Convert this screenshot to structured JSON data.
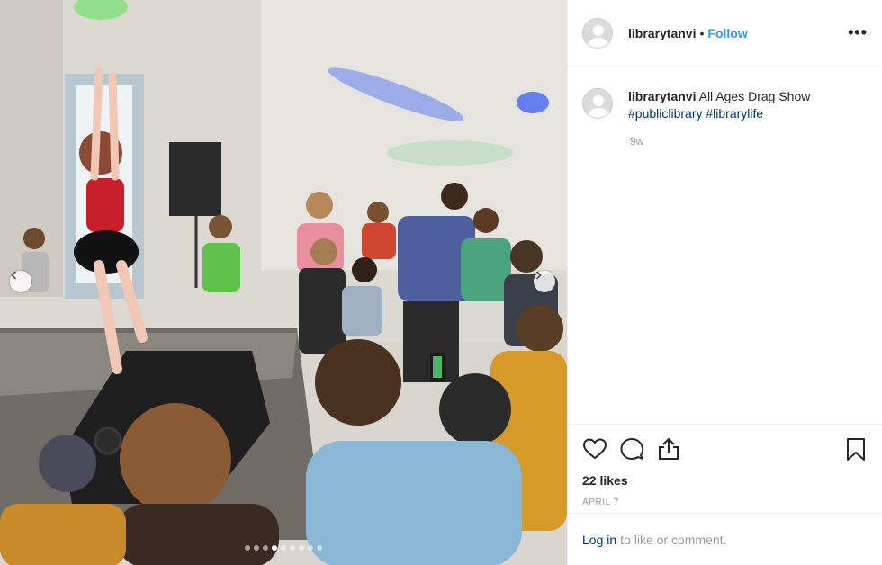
{
  "post": {
    "photo_alt": "Photo",
    "slide_count": 9,
    "active_slide": 3
  },
  "header": {
    "username": "librarytanvi",
    "separator": "•",
    "follow_label": "Follow",
    "more_label": "•••"
  },
  "caption": {
    "username": "librarytanvi",
    "text": "All Ages Drag Show",
    "hashtags": [
      "#publiclibrary",
      "#librarylife"
    ],
    "time_ago": "9w"
  },
  "actions": {
    "likes": "22 likes",
    "date": "APRIL 7",
    "icons": [
      "heart-icon",
      "comment-icon",
      "share-icon",
      "bookmark-icon"
    ]
  },
  "login": {
    "link": "Log in",
    "rest": "to like or comment."
  },
  "colors": {
    "link_blue": "#3897f0",
    "hashtag_blue": "#003569",
    "muted": "#999999"
  }
}
